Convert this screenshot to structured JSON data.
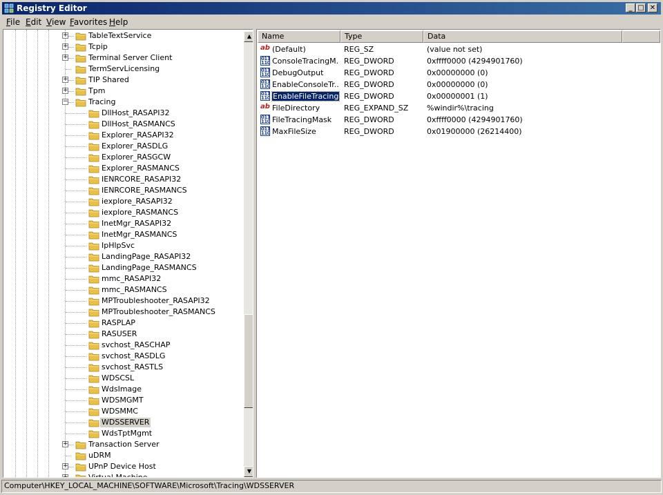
{
  "window": {
    "title": "Registry Editor",
    "controls": {
      "minimize": "_",
      "maximize": "□",
      "close": "✕"
    }
  },
  "menu": [
    {
      "underline": "F",
      "rest": "ile"
    },
    {
      "underline": "E",
      "rest": "dit"
    },
    {
      "underline": "V",
      "rest": "iew"
    },
    {
      "underline": "F",
      "rest": "avorites",
      "prefix": ""
    },
    {
      "underline": "H",
      "rest": "elp"
    }
  ],
  "tree": {
    "items": [
      {
        "label": "TableTextService",
        "level": 1,
        "expander": "+"
      },
      {
        "label": "Tcpip",
        "level": 1,
        "expander": "+"
      },
      {
        "label": "Terminal Server Client",
        "level": 1,
        "expander": "+"
      },
      {
        "label": "TermServLicensing",
        "level": 1,
        "expander": ""
      },
      {
        "label": "TIP Shared",
        "level": 1,
        "expander": "+"
      },
      {
        "label": "Tpm",
        "level": 1,
        "expander": "+"
      },
      {
        "label": "Tracing",
        "level": 1,
        "expander": "−"
      },
      {
        "label": "DllHost_RASAPI32",
        "level": 2
      },
      {
        "label": "DllHost_RASMANCS",
        "level": 2
      },
      {
        "label": "Explorer_RASAPI32",
        "level": 2
      },
      {
        "label": "Explorer_RASDLG",
        "level": 2
      },
      {
        "label": "Explorer_RASGCW",
        "level": 2
      },
      {
        "label": "Explorer_RASMANCS",
        "level": 2
      },
      {
        "label": "IENRCORE_RASAPI32",
        "level": 2
      },
      {
        "label": "IENRCORE_RASMANCS",
        "level": 2
      },
      {
        "label": "iexplore_RASAPI32",
        "level": 2
      },
      {
        "label": "iexplore_RASMANCS",
        "level": 2
      },
      {
        "label": "InetMgr_RASAPI32",
        "level": 2
      },
      {
        "label": "InetMgr_RASMANCS",
        "level": 2
      },
      {
        "label": "IpHlpSvc",
        "level": 2
      },
      {
        "label": "LandingPage_RASAPI32",
        "level": 2
      },
      {
        "label": "LandingPage_RASMANCS",
        "level": 2
      },
      {
        "label": "mmc_RASAPI32",
        "level": 2
      },
      {
        "label": "mmc_RASMANCS",
        "level": 2
      },
      {
        "label": "MPTroubleshooter_RASAPI32",
        "level": 2
      },
      {
        "label": "MPTroubleshooter_RASMANCS",
        "level": 2
      },
      {
        "label": "RASPLAP",
        "level": 2
      },
      {
        "label": "RASUSER",
        "level": 2
      },
      {
        "label": "svchost_RASCHAP",
        "level": 2
      },
      {
        "label": "svchost_RASDLG",
        "level": 2
      },
      {
        "label": "svchost_RASTLS",
        "level": 2
      },
      {
        "label": "WDSCSL",
        "level": 2
      },
      {
        "label": "WdsImage",
        "level": 2
      },
      {
        "label": "WDSMGMT",
        "level": 2
      },
      {
        "label": "WDSMMC",
        "level": 2
      },
      {
        "label": "WDSSERVER",
        "level": 2,
        "selected": true
      },
      {
        "label": "WdsTptMgmt",
        "level": 2
      },
      {
        "label": "Transaction Server",
        "level": 1,
        "expander": "+"
      },
      {
        "label": "uDRM",
        "level": 1,
        "expander": ""
      },
      {
        "label": "UPnP Device Host",
        "level": 1,
        "expander": "+"
      },
      {
        "label": "Virtual Machine",
        "level": 1,
        "expander": "+"
      }
    ]
  },
  "list": {
    "headers": {
      "name": "Name",
      "type": "Type",
      "data": "Data"
    },
    "rows": [
      {
        "icon": "string-value-icon",
        "name": "(Default)",
        "type": "REG_SZ",
        "data": "(value not set)"
      },
      {
        "icon": "binary-value-icon",
        "name": "ConsoleTracingM...",
        "type": "REG_DWORD",
        "data": "0xffff0000 (4294901760)"
      },
      {
        "icon": "binary-value-icon",
        "name": "DebugOutput",
        "type": "REG_DWORD",
        "data": "0x00000000 (0)"
      },
      {
        "icon": "binary-value-icon",
        "name": "EnableConsoleTr...",
        "type": "REG_DWORD",
        "data": "0x00000000 (0)"
      },
      {
        "icon": "binary-value-icon",
        "name": "EnableFileTracing",
        "type": "REG_DWORD",
        "data": "0x00000001 (1)",
        "selected": true
      },
      {
        "icon": "string-value-icon",
        "name": "FileDirectory",
        "type": "REG_EXPAND_SZ",
        "data": "%windir%\\tracing"
      },
      {
        "icon": "binary-value-icon",
        "name": "FileTracingMask",
        "type": "REG_DWORD",
        "data": "0xffff0000 (4294901760)"
      },
      {
        "icon": "binary-value-icon",
        "name": "MaxFileSize",
        "type": "REG_DWORD",
        "data": "0x01900000 (26214400)"
      }
    ]
  },
  "status": {
    "path": "Computer\\HKEY_LOCAL_MACHINE\\SOFTWARE\\Microsoft\\Tracing\\WDSSERVER"
  },
  "colors": {
    "title_start": "#0a246a",
    "title_end": "#3a6ea5",
    "selection": "#0a246a",
    "folder": "#e8c04c",
    "chrome": "#d4d0c8"
  }
}
